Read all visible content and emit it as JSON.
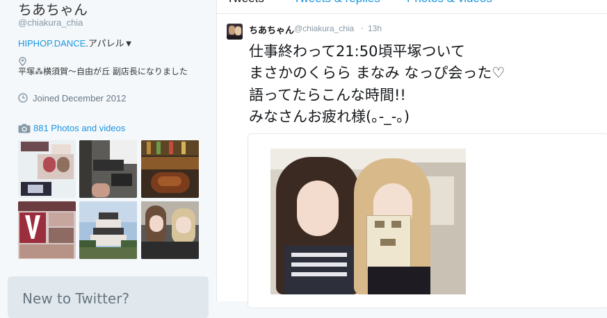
{
  "profile": {
    "display_name": "ちあちゃん",
    "handle": "@chiakura_chia",
    "bio_link": "HIPHOP.DANCE",
    "bio_rest": ".アパレル▼",
    "location": "平塚⁂横須賀〜自由が丘 副店長になりました",
    "joined": "Joined December 2012",
    "photos_label": "881 Photos and videos",
    "new_to_twitter": "New to Twitter?"
  },
  "tabs": [
    {
      "label": "Tweets"
    },
    {
      "label": "Tweets & replies"
    },
    {
      "label": "Photos & videos"
    }
  ],
  "tweet": {
    "name": "ちあちゃん",
    "handle": "@chiakura_chia",
    "separator": "·",
    "time": "13h",
    "lines": [
      "仕事終わって21:50頃平塚ついて",
      "まさかのくらら まなみ なっぴ会った♡",
      "語ってたらこんな時間!!",
      "みなさんお疲れ様(｡-_-｡)"
    ]
  },
  "colors": {
    "accent": "#1b95e0",
    "text": "#14171a",
    "muted": "#8899a6",
    "sidebar_bg": "#f5f8fa"
  },
  "icons": [
    "location-pin-icon",
    "clock-icon",
    "camera-icon"
  ]
}
